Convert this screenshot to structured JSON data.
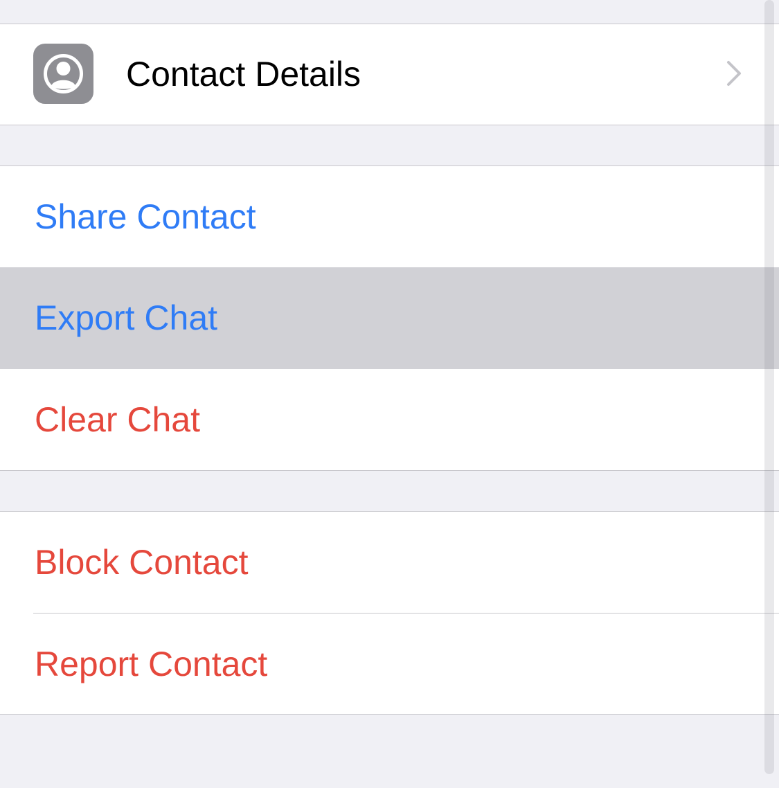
{
  "contact_group": {
    "contact_details_label": "Contact Details",
    "avatar_icon": "person-circle-icon",
    "chevron_icon": "chevron-right-icon"
  },
  "actions_group": {
    "items": [
      {
        "label": "Share Contact",
        "color": "#2f7cf6"
      },
      {
        "label": "Export Chat",
        "color": "#2f7cf6",
        "state": "pressed"
      },
      {
        "label": "Clear Chat",
        "color": "#e5483c"
      }
    ]
  },
  "danger_group": {
    "items": [
      {
        "label": "Block Contact",
        "color": "#e5483c"
      },
      {
        "label": "Report Contact",
        "color": "#e5483c"
      }
    ]
  },
  "colors": {
    "background": "#f0f0f5",
    "cell": "#ffffff",
    "separator": "#c8c7cc",
    "highlight": "#d1d1d6",
    "accent_blue": "#2f7cf6",
    "destructive_red": "#e5483c",
    "avatar_tile": "#8e8e93"
  }
}
